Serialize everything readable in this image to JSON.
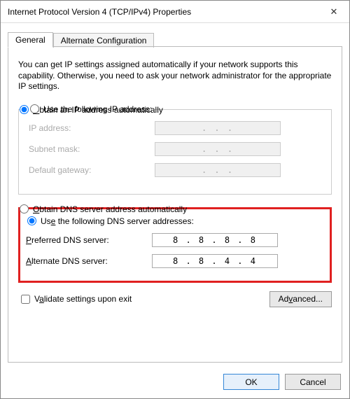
{
  "window": {
    "title": "Internet Protocol Version 4 (TCP/IPv4) Properties",
    "close_icon": "✕"
  },
  "tabs": {
    "general": "General",
    "alternate": "Alternate Configuration"
  },
  "intro": "You can get IP settings assigned automatically if your network supports this capability. Otherwise, you need to ask your network administrator for the appropriate IP settings.",
  "ip": {
    "auto_label_pre": "O",
    "auto_label_rest": "btain an IP address automatically",
    "manual_label_pre": "Use the following IP address:",
    "fields": {
      "ip_label": "IP address:",
      "ip_value": ".   .   .",
      "subnet_label": "Subnet mask:",
      "subnet_value": ".   .   .",
      "gateway_label": "Default gateway:",
      "gateway_value": ".   .   ."
    },
    "selected": "auto"
  },
  "dns": {
    "auto_label": "Obtain DNS server address automatically",
    "manual_label": "Use the following DNS server addresses:",
    "fields": {
      "pref_label": "Preferred DNS server:",
      "pref_value": "8 . 8 . 8 . 8",
      "alt_label": "Alternate DNS server:",
      "alt_value": "8 . 8 . 4 . 4"
    },
    "selected": "manual"
  },
  "validate": {
    "label": "Validate settings upon exit",
    "checked": false
  },
  "buttons": {
    "advanced": "Advanced...",
    "ok": "OK",
    "cancel": "Cancel"
  }
}
